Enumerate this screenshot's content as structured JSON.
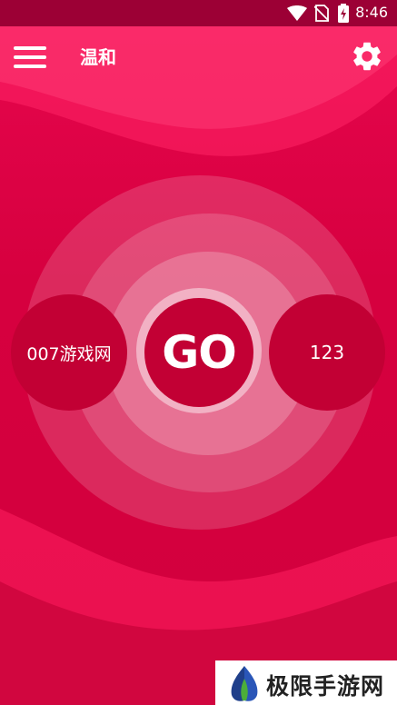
{
  "status_bar": {
    "time": "8:46",
    "icons": [
      "wifi-icon",
      "no-sim-icon",
      "battery-charging-icon"
    ]
  },
  "app_bar": {
    "title": "温和",
    "menu_icon": "hamburger-menu-icon",
    "settings_icon": "gear-icon"
  },
  "main": {
    "go_label": "GO",
    "left_option": "007游戏网",
    "right_option": "123"
  },
  "watermark": {
    "text": "极限手游网",
    "logo_icon": "leaf-logo-icon"
  },
  "colors": {
    "background": "#d6003f",
    "status_bar": "#9c0035",
    "button": "#c20034",
    "accent_wave": "#ff1a5e"
  }
}
